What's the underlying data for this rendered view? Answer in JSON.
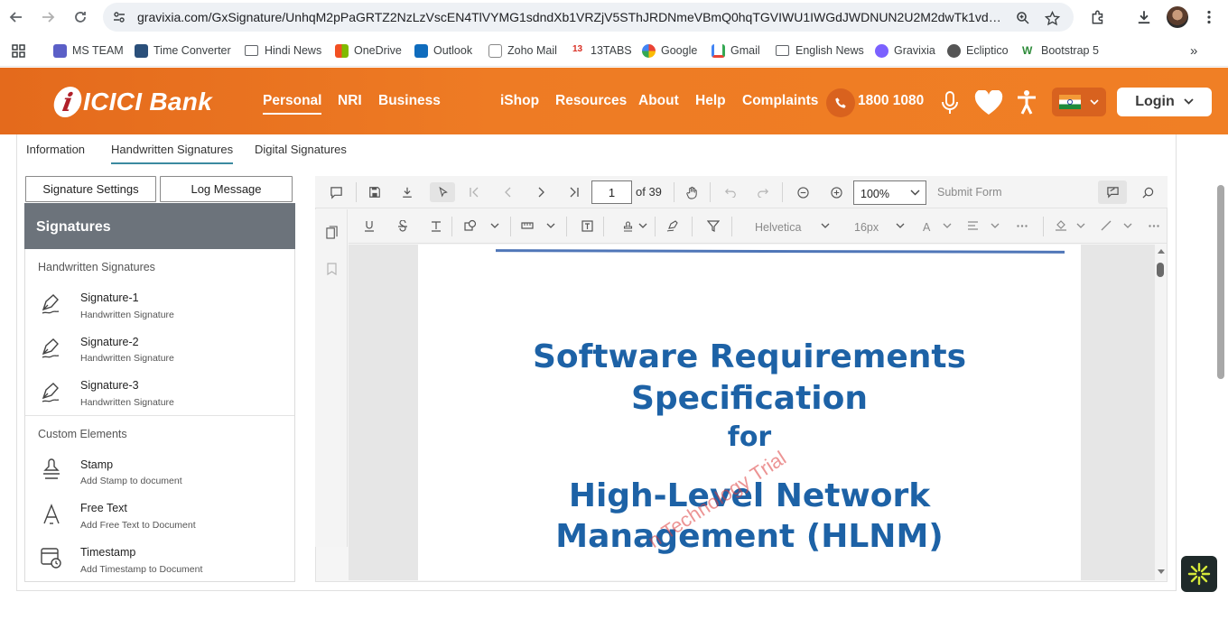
{
  "browser": {
    "url": "gravixia.com/GxSignature/UnhqM2pPaGRTZ2NzLzVscEN4TlVYMG1sdndXb1VRZjV5SThJRDNmeVBmQ0hqTGVIWU1IWGdJWDNUN2U2M2dwTk1vd0VXM..."
  },
  "bookmarks": [
    {
      "label": "MS TEAM",
      "color": "#5b5fc7"
    },
    {
      "label": "Time Converter",
      "color": "#2a4f7a"
    },
    {
      "label": "Hindi News",
      "color": ""
    },
    {
      "label": "OneDrive",
      "color": "#e8542c"
    },
    {
      "label": "Outlook",
      "color": "#0f6cbd"
    },
    {
      "label": "Zoho Mail",
      "color": "#888888"
    },
    {
      "label": "13TABS",
      "color": "#d93025"
    },
    {
      "label": "Google",
      "color": "#4285f4"
    },
    {
      "label": "Gmail",
      "color": "#ea4335"
    },
    {
      "label": "English News",
      "color": ""
    },
    {
      "label": "Gravixia",
      "color": "#7b61ff"
    },
    {
      "label": "Ecliptico",
      "color": "#555555"
    },
    {
      "label": "Bootstrap 5",
      "color": "#2e8b3a"
    }
  ],
  "bank": {
    "logo_text": "ICICI Bank",
    "nav": [
      "Personal",
      "NRI",
      "Business",
      "iShop",
      "Resources",
      "About",
      "Help",
      "Complaints"
    ],
    "phone": "1800 1080",
    "login": "Login"
  },
  "tabs": [
    "Information",
    "Handwritten Signatures",
    "Digital Signatures"
  ],
  "side_buttons": [
    "Signature Settings",
    "Log Message"
  ],
  "signatures": {
    "title": "Signatures",
    "handwritten_title": "Handwritten Signatures",
    "handwritten": [
      {
        "name": "Signature-1",
        "sub": "Handwritten Signature"
      },
      {
        "name": "Signature-2",
        "sub": "Handwritten Signature"
      },
      {
        "name": "Signature-3",
        "sub": "Handwritten Signature"
      }
    ],
    "custom_title": "Custom Elements",
    "custom": [
      {
        "name": "Stamp",
        "sub": "Add Stamp to document"
      },
      {
        "name": "Free Text",
        "sub": "Add Free Text to Document"
      },
      {
        "name": "Timestamp",
        "sub": "Add Timestamp to Document"
      }
    ]
  },
  "viewer": {
    "page_current": "1",
    "page_of": "of 39",
    "zoom": "100%",
    "submit_form": "Submit Form",
    "font_name": "Helvetica",
    "font_size": "16px",
    "font_color_letter": "A"
  },
  "document": {
    "line1": "Software Requirements",
    "line2": "Specification",
    "line3": "for",
    "line4": "High-Level Network",
    "line5": "Management (HLNM)",
    "watermark": "n Technology Trial"
  }
}
